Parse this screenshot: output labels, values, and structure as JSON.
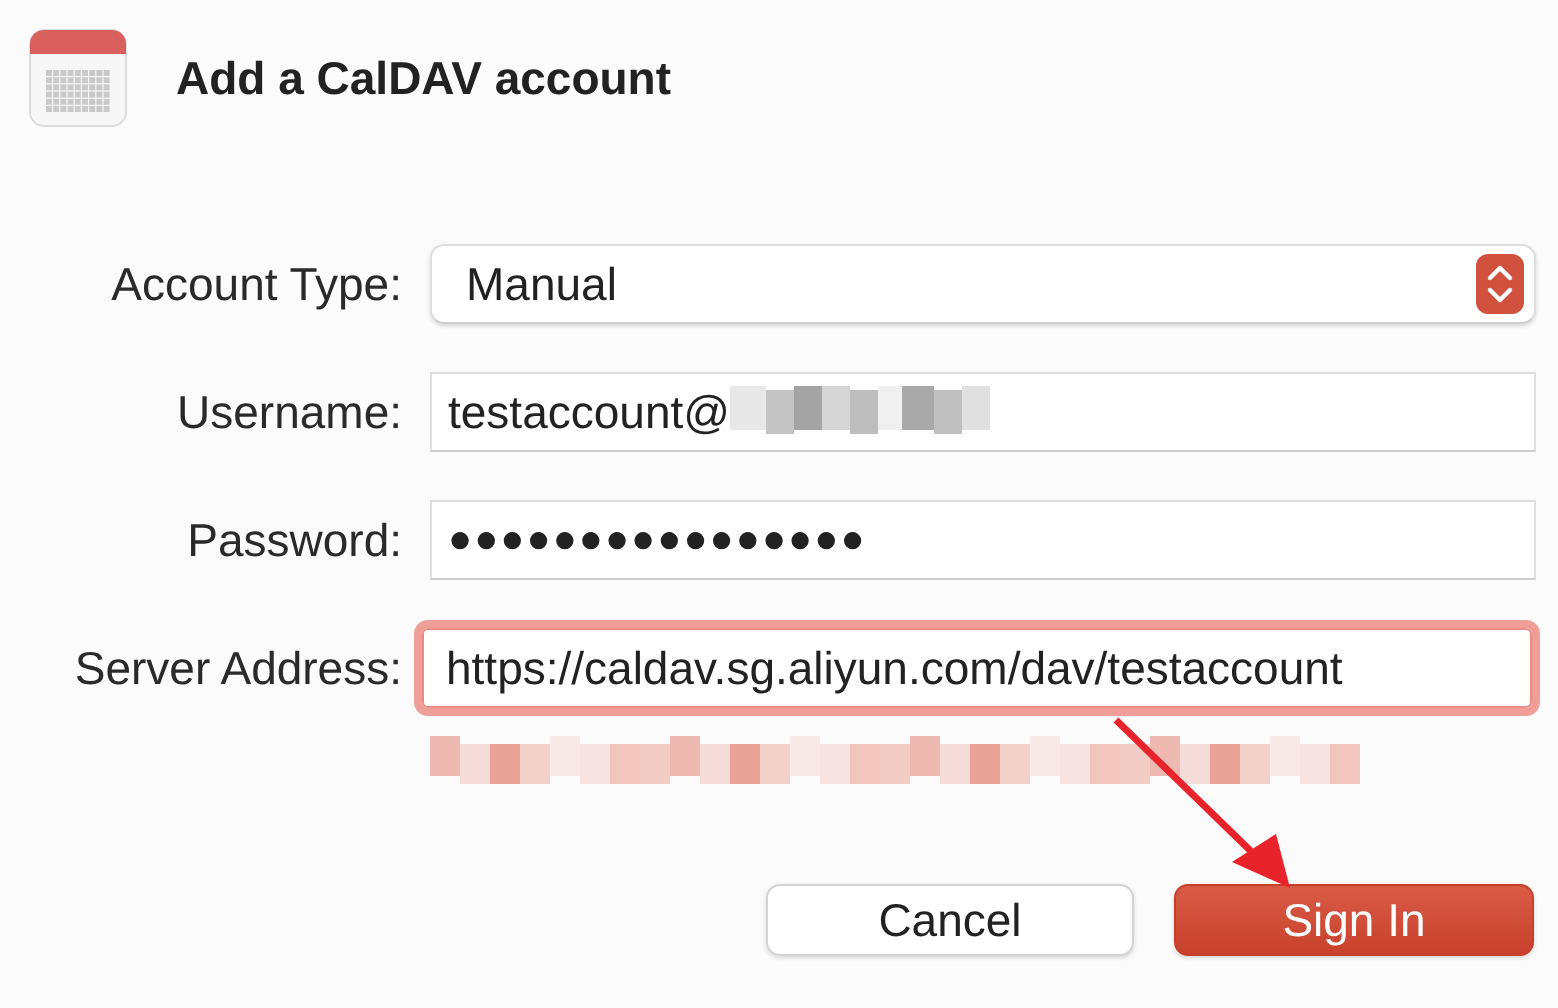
{
  "dialog": {
    "title": "Add a CalDAV account"
  },
  "fields": [
    {
      "kind": "select",
      "label": "Account Type:",
      "value": "Manual",
      "focused": false
    },
    {
      "kind": "text",
      "label": "Username:",
      "value": "testaccount@",
      "focused": false
    },
    {
      "kind": "password",
      "label": "Password:",
      "value": "●●●●●●●●●●●●●●●●",
      "focused": false
    },
    {
      "kind": "text",
      "label": "Server Address:",
      "value": "https://caldav.sg.aliyun.com/dav/testaccount",
      "focused": true
    }
  ],
  "buttons": [
    {
      "label": "Cancel",
      "kind": "secondary"
    },
    {
      "label": "Sign In",
      "kind": "primary"
    }
  ]
}
